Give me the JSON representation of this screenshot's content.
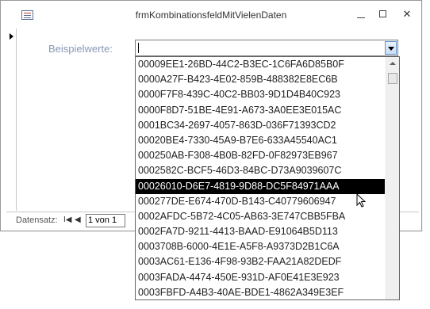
{
  "window": {
    "title": "frmKombinationsfeldMitVielenDaten",
    "controls": {
      "minimize": "minimize-icon",
      "maximize": "maximize-icon",
      "close": "✕"
    }
  },
  "form": {
    "field_label": "Beispielwerte:",
    "combo_value": ""
  },
  "dropdown": {
    "selected_index": 8,
    "items": [
      "00009EE1-26BD-44C2-B3EC-1C6FA6D85B0F",
      "0000A27F-B423-4E02-859B-488382E8EC6B",
      "0000F7F8-439C-40C2-BB03-9D1D4B40C923",
      "0000F8D7-51BE-4E91-A673-3A0EE3E015AC",
      "0001BC34-2697-4057-863D-036F71393CD2",
      "00020BE4-7330-45A9-B7E6-633A45540AC1",
      "000250AB-F308-4B0B-82FD-0F82973EB967",
      "0002582C-BCF5-46D3-84BC-D73A9039607C",
      "00026010-D6E7-4819-9D88-DC5F84971AAA",
      "000277DE-E674-470D-B143-C40779606947",
      "0002AFDC-5B72-4C05-AB63-3E747CBB5FBA",
      "0002FA7D-9211-4413-BAAD-E91064B5D113",
      "0003708B-6000-4E1E-A5F8-A9373D2B1C6A",
      "0003AC61-E136-4F98-93B2-FAA21A82DEDF",
      "0003FADA-4474-450E-931D-AF0E41E3E923",
      "0003FBFD-A4B3-40AE-BDE1-4862A349E3EF"
    ]
  },
  "navigation": {
    "label": "Datensatz:",
    "first_glyph": "I◀",
    "prev_glyph": "◀",
    "position": "1 von 1"
  },
  "colors": {
    "label": "#8798b8",
    "selection_bg": "#000000",
    "selection_fg": "#ffffff"
  }
}
